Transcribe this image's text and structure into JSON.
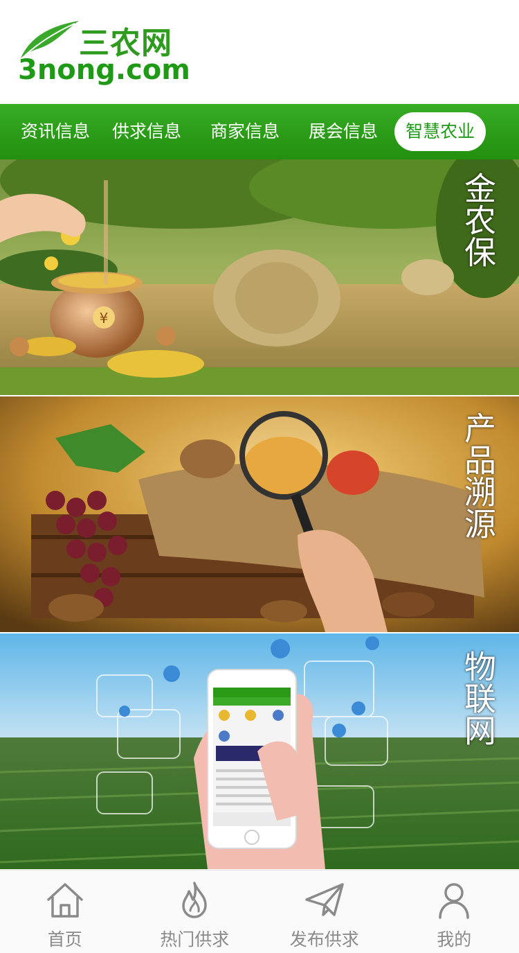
{
  "logo": {
    "chinese": "三农网",
    "domain": "3nong.com"
  },
  "nav": {
    "items": [
      {
        "label": "资讯信息"
      },
      {
        "label": "供求信息"
      },
      {
        "label": "商家信息"
      },
      {
        "label": "展会信息"
      },
      {
        "label": "智慧农业",
        "active": true
      }
    ]
  },
  "banners": [
    {
      "label": "金农保"
    },
    {
      "label": "产品溯源"
    },
    {
      "label": "物联网"
    }
  ],
  "tabbar": {
    "items": [
      {
        "label": "首页",
        "icon": "home-icon"
      },
      {
        "label": "热门供求",
        "icon": "flame-icon"
      },
      {
        "label": "发布供求",
        "icon": "paper-plane-icon"
      },
      {
        "label": "我的",
        "icon": "user-icon"
      }
    ]
  },
  "colors": {
    "brand_green": "#2a9a17",
    "tab_gray": "#8a8a8a"
  }
}
